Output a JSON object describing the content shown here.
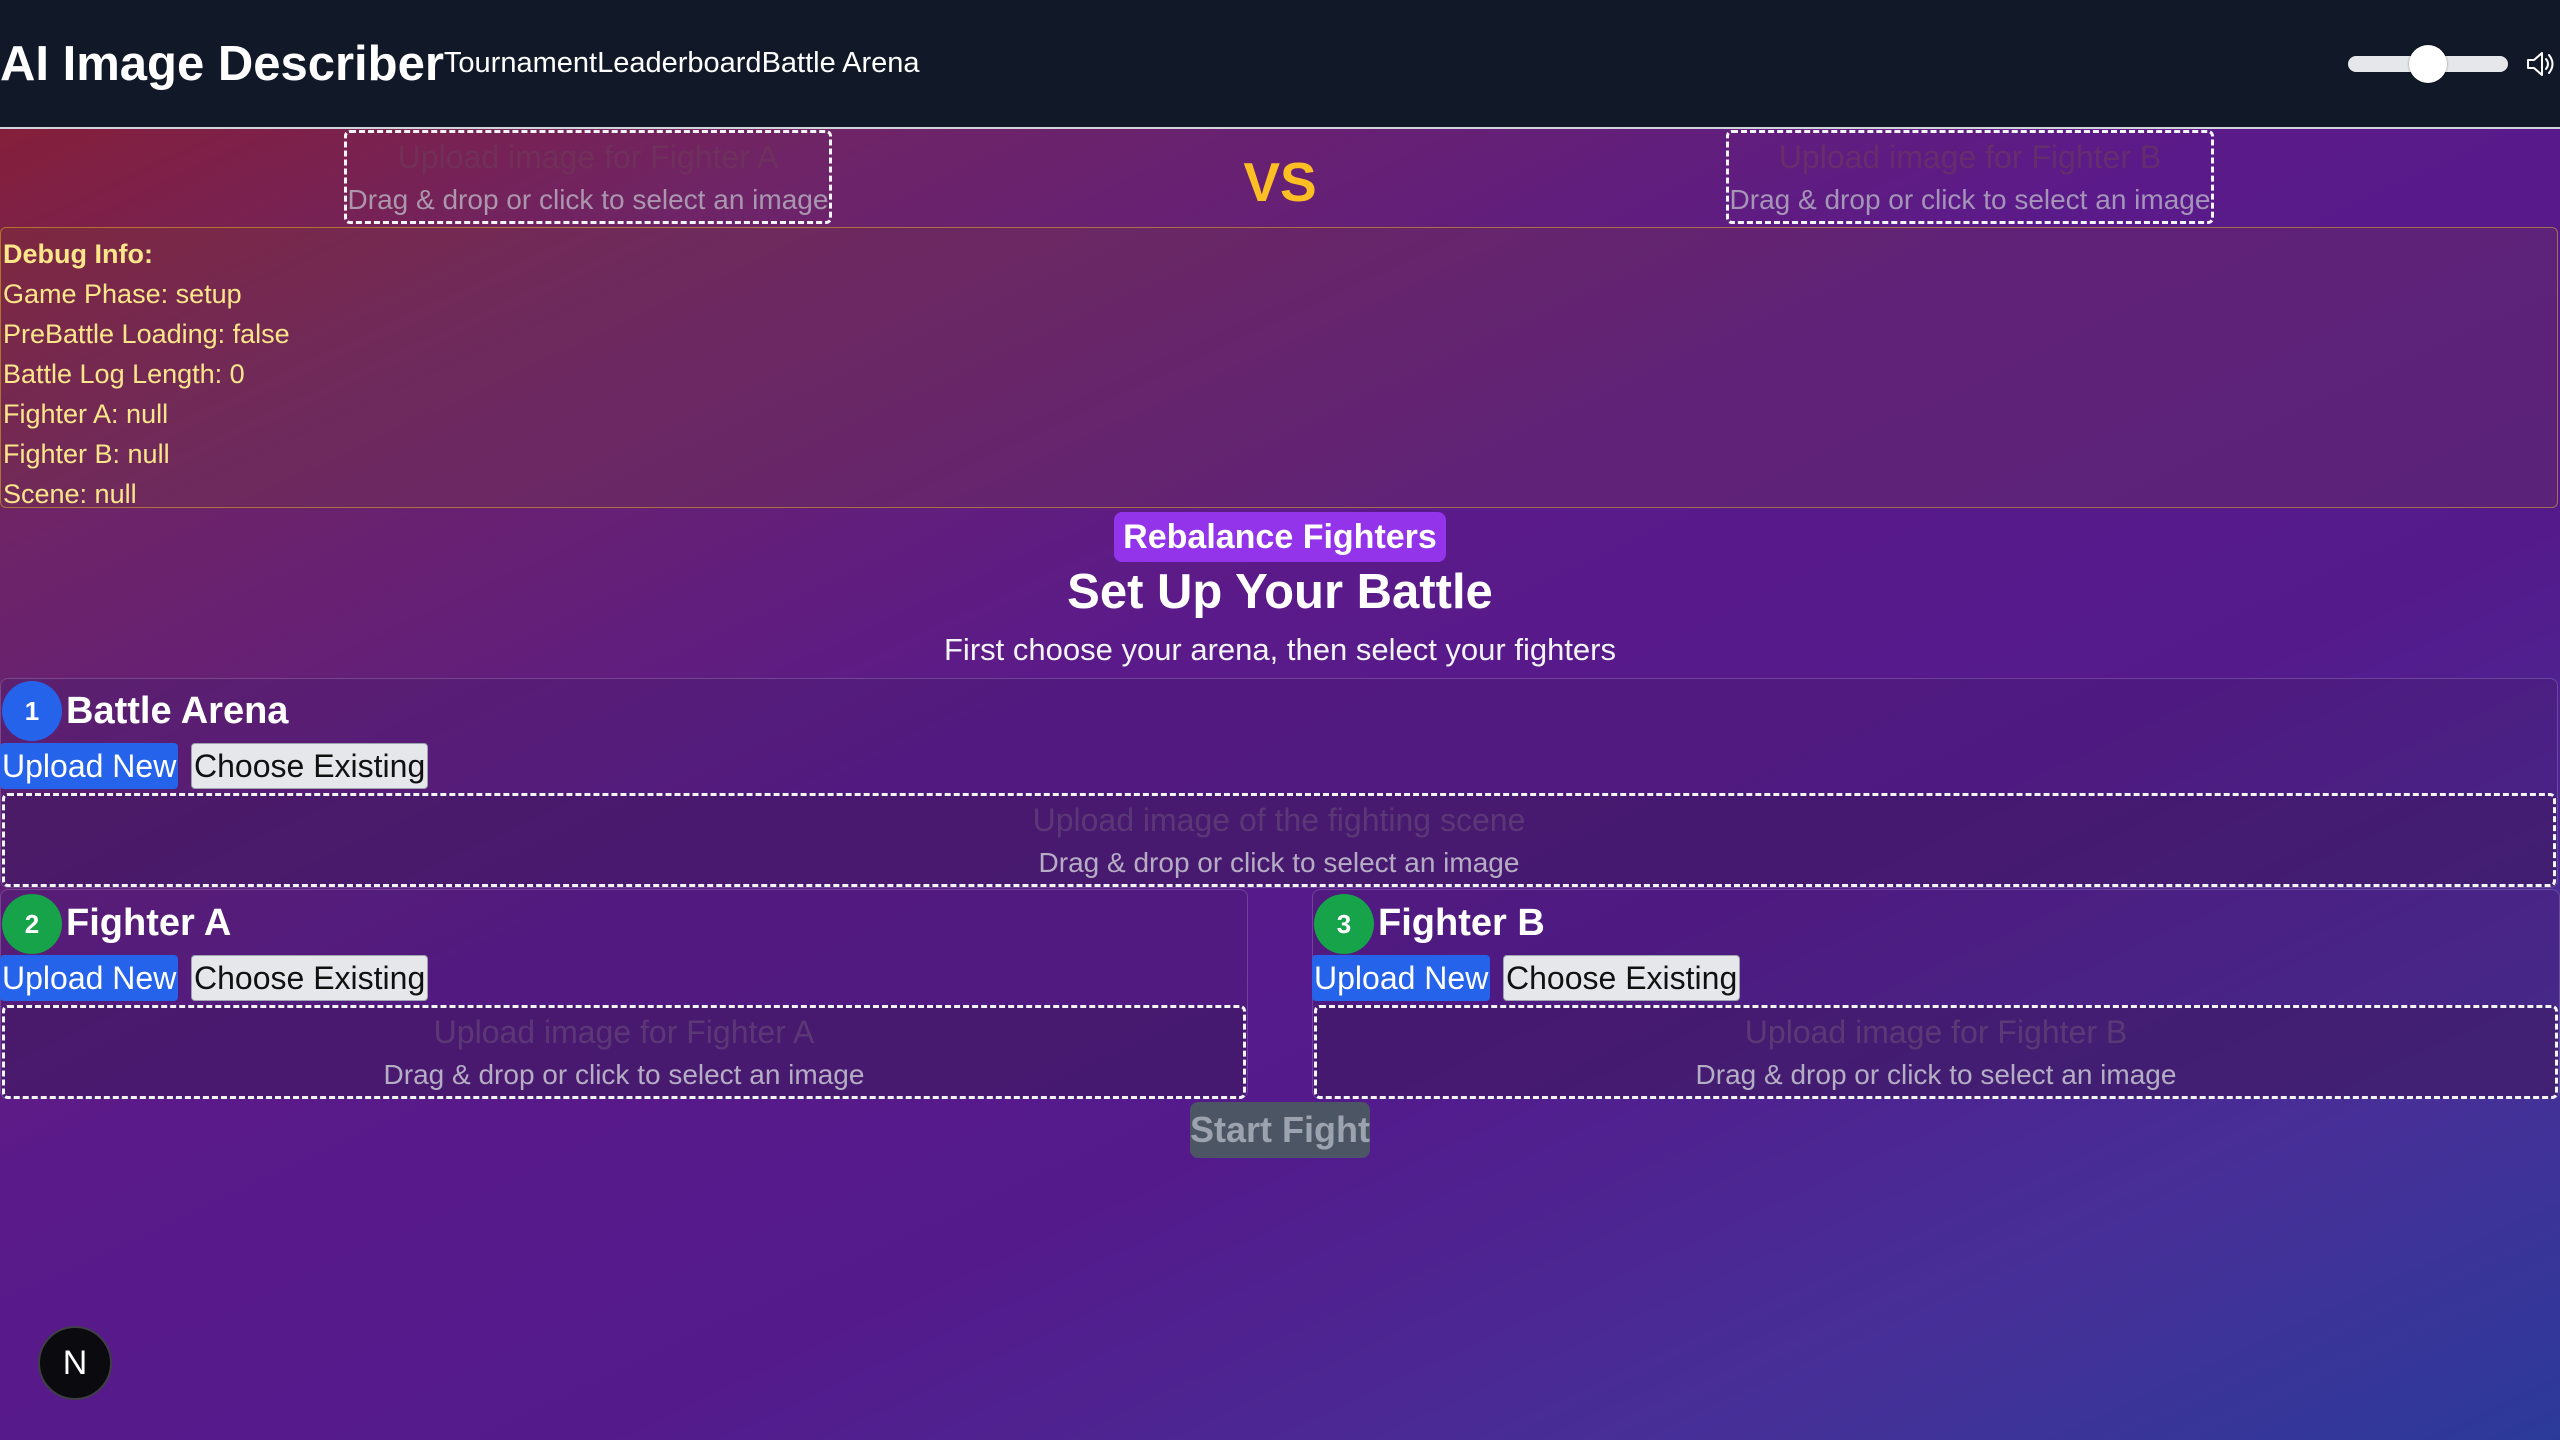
{
  "header": {
    "app_title": "AI Image Describer",
    "nav": [
      "Tournament",
      "Leaderboard",
      "Battle Arena"
    ],
    "volume_level": 0.5
  },
  "top_upload": {
    "fighter_a": {
      "title": "Upload image for Fighter A",
      "subtitle": "Drag & drop or click to select an image"
    },
    "vs": "VS",
    "fighter_b": {
      "title": "Upload image for Fighter B",
      "subtitle": "Drag & drop or click to select an image"
    }
  },
  "debug": {
    "title": "Debug Info:",
    "lines": [
      "Game Phase: setup",
      "PreBattle Loading: false",
      "Battle Log Length: 0",
      "Fighter A: null",
      "Fighter B: null",
      "Scene: null"
    ]
  },
  "rebalance_label": "Rebalance Fighters",
  "setup": {
    "title": "Set Up Your Battle",
    "subtitle": "First choose your arena, then select your fighters"
  },
  "arena": {
    "step": "1",
    "title": "Battle Arena",
    "upload_label": "Upload New",
    "choose_label": "Choose Existing",
    "dz_title": "Upload image of the fighting scene",
    "dz_subtitle": "Drag & drop or click to select an image"
  },
  "fighter_a": {
    "step": "2",
    "title": "Fighter A",
    "upload_label": "Upload New",
    "choose_label": "Choose Existing",
    "dz_title": "Upload image for Fighter A",
    "dz_subtitle": "Drag & drop or click to select an image"
  },
  "fighter_b": {
    "step": "3",
    "title": "Fighter B",
    "upload_label": "Upload New",
    "choose_label": "Choose Existing",
    "dz_title": "Upload image for Fighter B",
    "dz_subtitle": "Drag & drop or click to select an image"
  },
  "start_label": "Start Fight",
  "badge_letter": "N",
  "colors": {
    "header_bg": "#111827",
    "accent_blue": "#2563eb",
    "accent_green": "#16a34a",
    "rebalance_purple": "#9333ea",
    "vs_yellow": "#fbbf24",
    "debug_text": "#fde68a"
  },
  "icons": {
    "volume": "speaker-icon",
    "badge": "next-logo-icon"
  }
}
